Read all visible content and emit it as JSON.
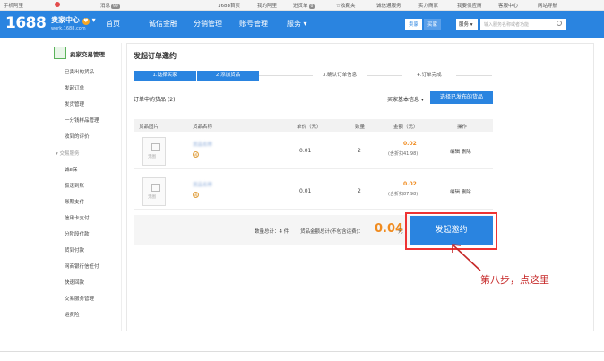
{
  "topbar": {
    "mobile": "手机阿里",
    "messages": "消息",
    "messages_count": "99",
    "home": "1688首页",
    "my_alibaba": "我的阿里",
    "purchase": "进货单",
    "purchase_count": "0",
    "favorites": "收藏夹",
    "integrity": "诚信通服务",
    "merchant": "实力商家",
    "buyer_supply": "我要供应商",
    "customer_service": "客服中心",
    "site_nav": "网站导航"
  },
  "header": {
    "logo": "1688",
    "seller_center": "卖家中心",
    "site": "work.1688.com",
    "nav": [
      "首页",
      "诚信金融",
      "分销管理",
      "账号管理",
      "服务"
    ],
    "tab_seller": "卖家",
    "tab_buyer": "买家",
    "search_type": "服务",
    "search_placeholder": "输入服务名称或者功能"
  },
  "sidebar": {
    "title": "卖家交易管理",
    "items": [
      "已卖出的货品",
      "发起订单",
      "发货管理",
      "一分钱样品管理",
      "收到的评价"
    ],
    "section": "交易服务",
    "service_items": [
      "诚e保",
      "极速到账",
      "账期支付",
      "信用卡支付",
      "分阶段付款",
      "货到付款",
      "网商银行信任付",
      "快速回款",
      "交易服务管理",
      "运费险"
    ]
  },
  "main": {
    "title": "发起订单邀约",
    "steps": [
      "1.选择买家",
      "2.添加货品",
      "3.确认订单信息",
      "4.订单完成"
    ],
    "goods_count": "订单中的货品 (2)",
    "seller_info": "买家基本信息",
    "select_button": "选择已发布的货品",
    "columns": [
      "货品图片",
      "货品名称",
      "单价（元）",
      "数量",
      "金额（元）",
      "操作"
    ],
    "rows": [
      {
        "thumb": "无图",
        "name": "货品名称",
        "price": "0.01",
        "qty": "2",
        "amount": "0.02",
        "discount": "(含折扣41.98)",
        "edit": "编辑",
        "delete": "删除"
      },
      {
        "thumb": "无图",
        "name": "货品名称",
        "price": "0.01",
        "qty": "2",
        "amount": "0.02",
        "discount": "(含折扣87.98)",
        "edit": "编辑",
        "delete": "删除"
      }
    ],
    "summary_qty_label": "数量总计：4 件",
    "summary_amount_label": "货品金额总计(不包含运费)：",
    "summary_total": "0.04",
    "summary_unit": "元",
    "submit": "发起邀约"
  },
  "annotation": "第八步，点这里",
  "colors": {
    "brand": "#2a84e0",
    "accent": "#f08b1f",
    "highlight": "#e33333"
  }
}
